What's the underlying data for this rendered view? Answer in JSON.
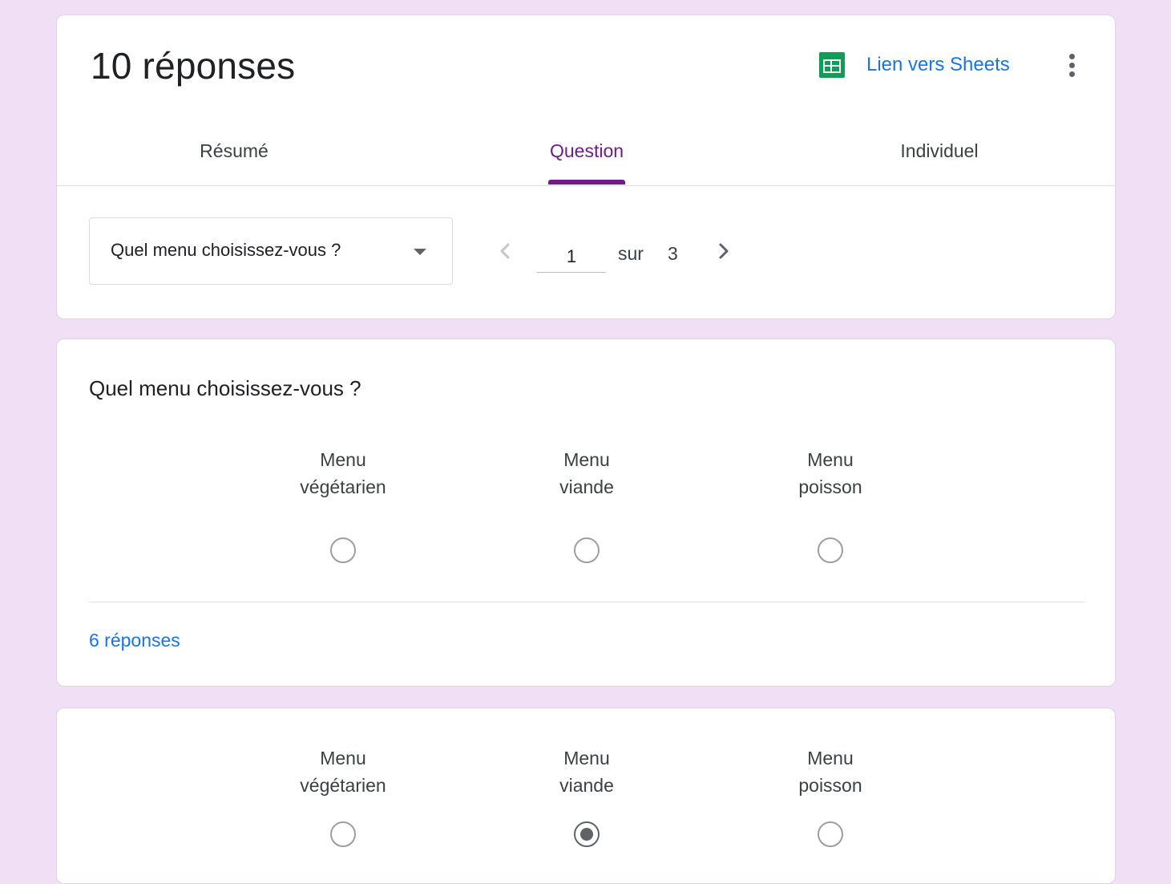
{
  "header": {
    "responses_title": "10 réponses",
    "sheets_link": "Lien vers Sheets",
    "tabs": [
      {
        "label": "Résumé",
        "active": false
      },
      {
        "label": "Question",
        "active": true
      },
      {
        "label": "Individuel",
        "active": false
      }
    ],
    "question_select": {
      "selected": "Quel menu choisissez-vous ?"
    },
    "pager": {
      "current": "1",
      "of_label": "sur",
      "total": "3"
    }
  },
  "question_card": {
    "title": "Quel menu choisissez-vous ?",
    "options": [
      {
        "line1": "Menu",
        "line2": "végétarien"
      },
      {
        "line1": "Menu",
        "line2": "viande"
      },
      {
        "line1": "Menu",
        "line2": "poisson"
      }
    ],
    "response_count": "6 réponses"
  },
  "response_card": {
    "options": [
      {
        "line1": "Menu",
        "line2": "végétarien",
        "selected": false
      },
      {
        "line1": "Menu",
        "line2": "viande",
        "selected": true
      },
      {
        "line1": "Menu",
        "line2": "poisson",
        "selected": false
      }
    ]
  },
  "colors": {
    "background": "#f1dff6",
    "accent_purple": "#6d1f86",
    "link_blue": "#1a73e8",
    "sheets_green": "#0f9d58"
  },
  "icons": [
    "sheets-icon",
    "more-vert-icon",
    "dropdown-caret-icon",
    "chevron-left-icon",
    "chevron-right-icon"
  ]
}
